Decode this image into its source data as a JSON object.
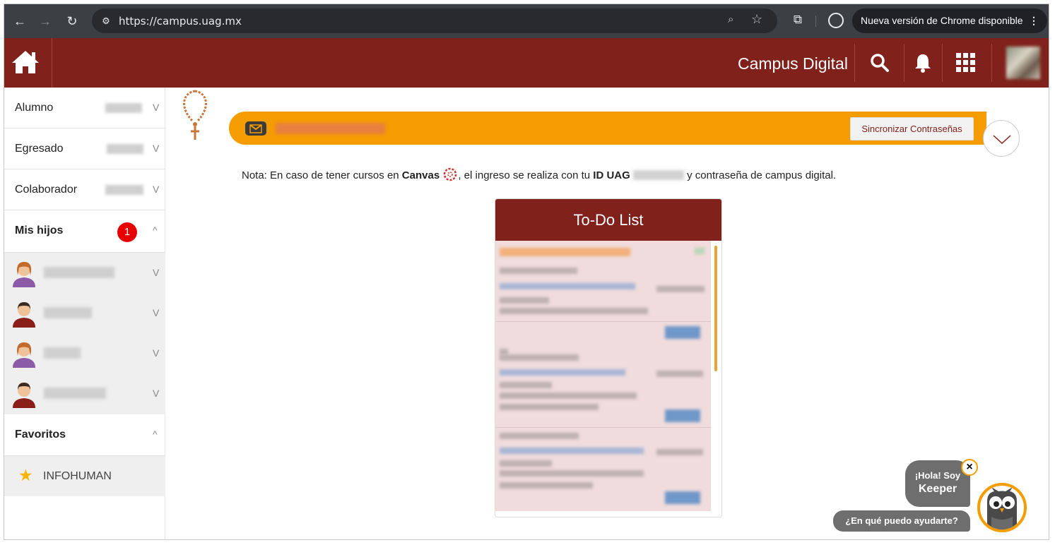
{
  "browser": {
    "url": "https://campus.uag.mx",
    "update_label": "Nueva versión de Chrome disponible"
  },
  "header": {
    "title": "Campus Digital"
  },
  "sidebar": {
    "sections": [
      {
        "label": "Alumno"
      },
      {
        "label": "Egresado"
      },
      {
        "label": "Colaborador"
      },
      {
        "label": "Mis hijos",
        "badge": "1"
      }
    ],
    "favorites": {
      "label": "Favoritos",
      "items": [
        {
          "label": "INFOHUMAN",
          "icon": "star-icon"
        }
      ]
    }
  },
  "banner": {
    "sync_button": "Sincronizar Contraseñas"
  },
  "note": {
    "prefix": "Nota: En caso de tener cursos en ",
    "canvas": "Canvas",
    "middle": ", el ingreso se realiza con tu ",
    "id": "ID UAG",
    "suffix": " y contraseña de campus digital."
  },
  "todo": {
    "title": "To-Do List"
  },
  "keeper": {
    "line1": "¡Hola! Soy",
    "line2": "Keeper",
    "ask": "¿En qué puedo ayudarte?"
  },
  "colors": {
    "brand": "#80211b",
    "accent": "#f59c00",
    "badge": "#e60000"
  }
}
